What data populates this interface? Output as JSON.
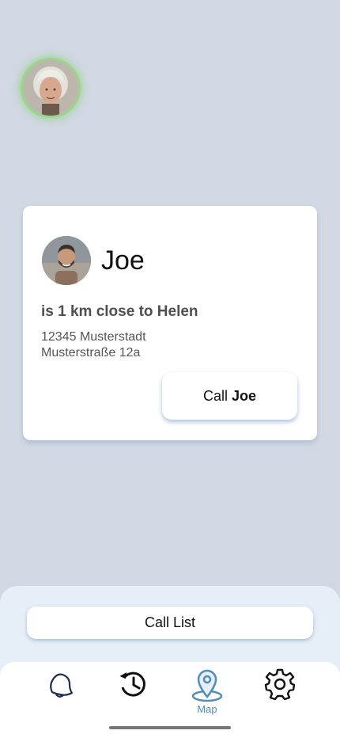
{
  "user": {
    "avatar_alt": "Helen"
  },
  "card": {
    "contact_name": "Joe",
    "distance_text": "is 1 km close to Helen",
    "address_line1": "12345 Musterstadt",
    "address_line2": "Musterstraße 12a",
    "call_prefix": "Call",
    "call_name": "Joe"
  },
  "sheet": {
    "call_list_label": "Call List"
  },
  "nav": {
    "items": [
      {
        "icon": "bell-icon",
        "label": ""
      },
      {
        "icon": "history-icon",
        "label": ""
      },
      {
        "icon": "map-pin-icon",
        "label": "Map",
        "active": true
      },
      {
        "icon": "gear-icon",
        "label": ""
      }
    ]
  },
  "colors": {
    "background": "#d1d8e3",
    "accent": "#4f8db8",
    "avatar_glow": "#9bd48a"
  }
}
